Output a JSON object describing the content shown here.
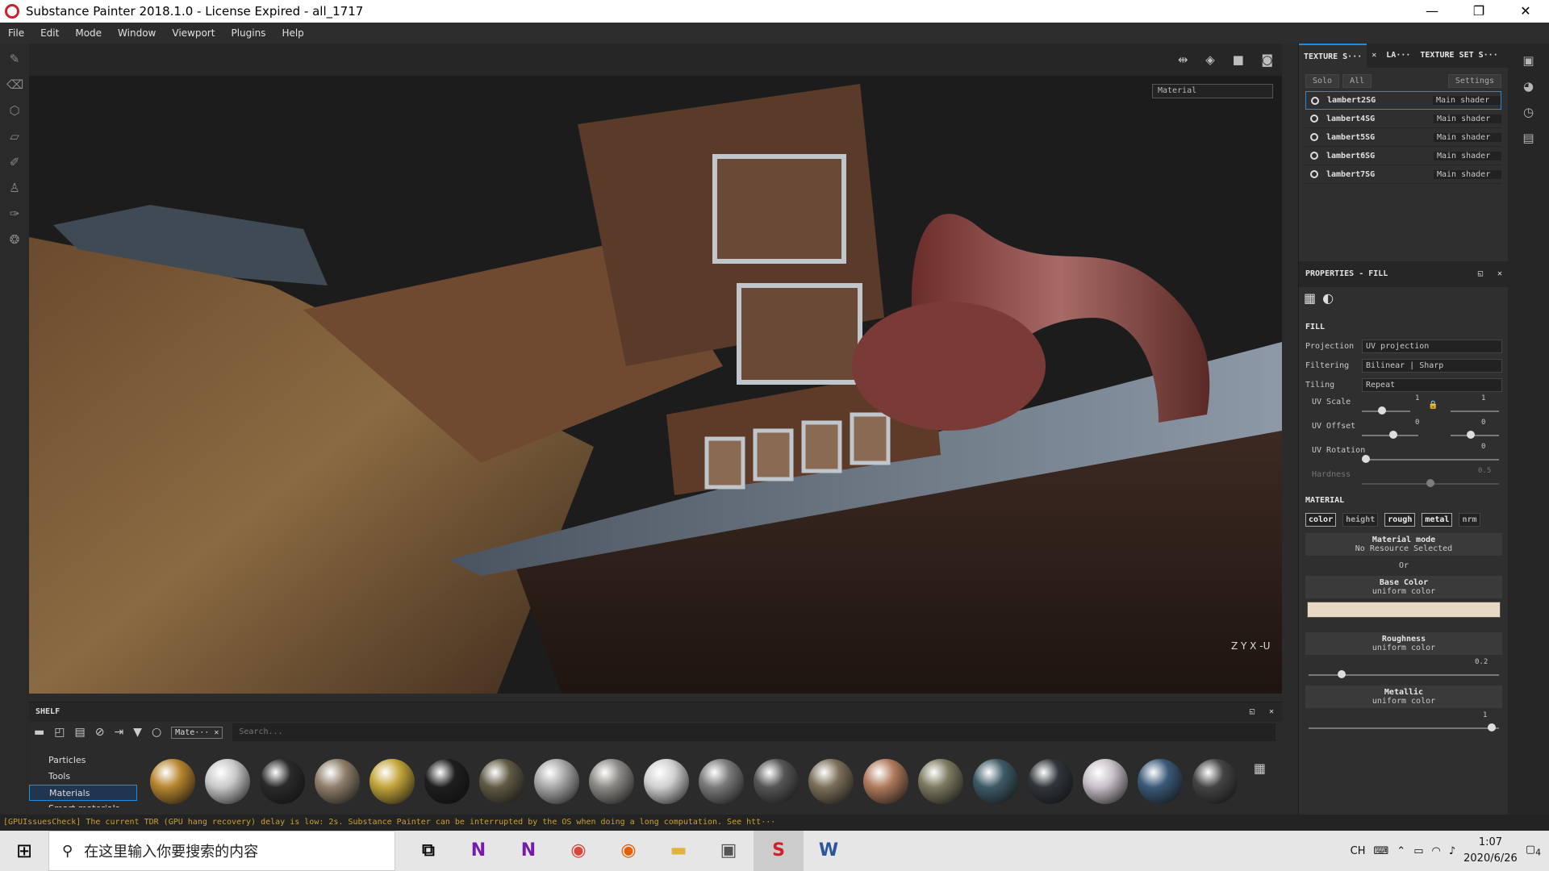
{
  "window": {
    "title": "Substance Painter 2018.1.0 - License Expired - all_1717",
    "minimize": "—",
    "restore": "❐",
    "close": "✕"
  },
  "menu": [
    "File",
    "Edit",
    "Mode",
    "Window",
    "Viewport",
    "Plugins",
    "Help"
  ],
  "viewport": {
    "display_mode": "Material",
    "axis_label": "Z  Y  X",
    "axis_u": "-U"
  },
  "texture_set_panel": {
    "tabs": [
      "TEXTURE S···",
      "LA···",
      "TEXTURE SET S···"
    ],
    "solo": "Solo",
    "all": "All",
    "settings": "Settings",
    "rows": [
      {
        "name": "lambert2SG",
        "shader": "Main shader"
      },
      {
        "name": "lambert4SG",
        "shader": "Main shader"
      },
      {
        "name": "lambert5SG",
        "shader": "Main shader"
      },
      {
        "name": "lambert6SG",
        "shader": "Main shader"
      },
      {
        "name": "lambert7SG",
        "shader": "Main shader"
      }
    ]
  },
  "properties": {
    "title": "PROPERTIES - FILL",
    "fill_section": "FILL",
    "projection_label": "Projection",
    "projection_value": "UV projection",
    "filtering_label": "Filtering",
    "filtering_value": "Bilinear | Sharp",
    "tiling_label": "Tiling",
    "tiling_value": "Repeat",
    "uv_scale_label": "UV Scale",
    "uv_scale_value": "1",
    "uv_scale_value2": "1",
    "uv_offset_label": "UV Offset",
    "uv_offset_value": "0",
    "uv_offset_value2": "0",
    "uv_rotation_label": "UV Rotation",
    "uv_rotation_value": "0",
    "hardness_label": "Hardness",
    "hardness_value": "0.5",
    "material_section": "MATERIAL",
    "channels": [
      "color",
      "height",
      "rough",
      "metal",
      "nrm"
    ],
    "material_mode_title": "Material mode",
    "material_mode_sub": "No Resource Selected",
    "or": "Or",
    "base_color_title": "Base Color",
    "base_color_sub": "uniform color",
    "base_color_swatch": "#e8d9c4",
    "roughness_title": "Roughness",
    "roughness_sub": "uniform color",
    "roughness_value": "0.2",
    "metallic_title": "Metallic",
    "metallic_sub": "uniform color",
    "metallic_value": "1"
  },
  "shelf": {
    "title": "SHELF",
    "filter_chip": "Mate···",
    "search_placeholder": "Search...",
    "categories": [
      "Particles",
      "Tools",
      "Materials",
      "Smart materials"
    ],
    "selected_category": "Materials",
    "material_colors": [
      "#b8862e",
      "#c9c9c9",
      "#2a2a2a",
      "#8f7e6a",
      "#c2a43a",
      "#1e1e1e",
      "#5f5a44",
      "#a8a8a8",
      "#8c8a86",
      "#d0d0d0",
      "#7a7a7a",
      "#555555",
      "#7c6f5a",
      "#b07a5c",
      "#7c7a60",
      "#3e5a66",
      "#30353a",
      "#c7c0c8",
      "#3a5a78",
      "#444444"
    ]
  },
  "status": {
    "message": "[GPUIssuesCheck] The current TDR (GPU hang recovery) delay is low: 2s. Substance Painter can be interrupted by the OS when doing a long computation. See htt···"
  },
  "taskbar": {
    "search_placeholder": "在这里输入你要搜索的内容",
    "ime": "CH",
    "time": "1:07",
    "date": "2020/6/26",
    "notifications": "4"
  }
}
